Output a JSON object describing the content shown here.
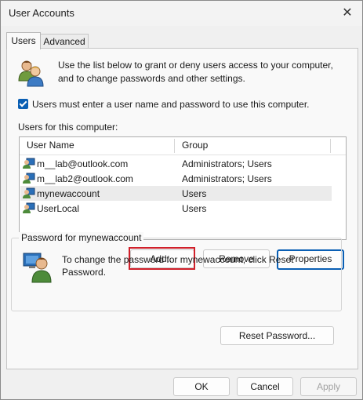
{
  "window": {
    "title": "User Accounts"
  },
  "tabs": [
    {
      "label": "Users"
    },
    {
      "label": "Advanced"
    }
  ],
  "intro": {
    "text": "Use the list below to grant or deny users access to your computer, and to change passwords and other settings."
  },
  "checkbox": {
    "label": "Users must enter a user name and password to use this computer.",
    "checked": true
  },
  "users": {
    "label": "Users for this computer:",
    "columns": {
      "name": "User Name",
      "group": "Group"
    },
    "rows": [
      {
        "name": "m__lab@outlook.com",
        "group": "Administrators; Users",
        "selected": false
      },
      {
        "name": "m__lab2@outlook.com",
        "group": "Administrators; Users",
        "selected": false
      },
      {
        "name": "mynewaccount",
        "group": "Users",
        "selected": true
      },
      {
        "name": "UserLocal",
        "group": "Users",
        "selected": false
      }
    ]
  },
  "buttons": {
    "add": "Add...",
    "remove": "Remove",
    "properties": "Properties",
    "reset_password": "Reset Password...",
    "ok": "OK",
    "cancel": "Cancel",
    "apply": "Apply"
  },
  "password": {
    "title": "Password for mynewaccount",
    "text": "To change the password for mynewaccount, click Reset Password."
  },
  "colors": {
    "accent": "#0a5fb4",
    "highlight": "#d0202a"
  },
  "icons": {
    "users": "users-icon",
    "user": "user-icon",
    "close": "close-icon",
    "password": "password-user-icon",
    "check": "checkmark-icon"
  }
}
